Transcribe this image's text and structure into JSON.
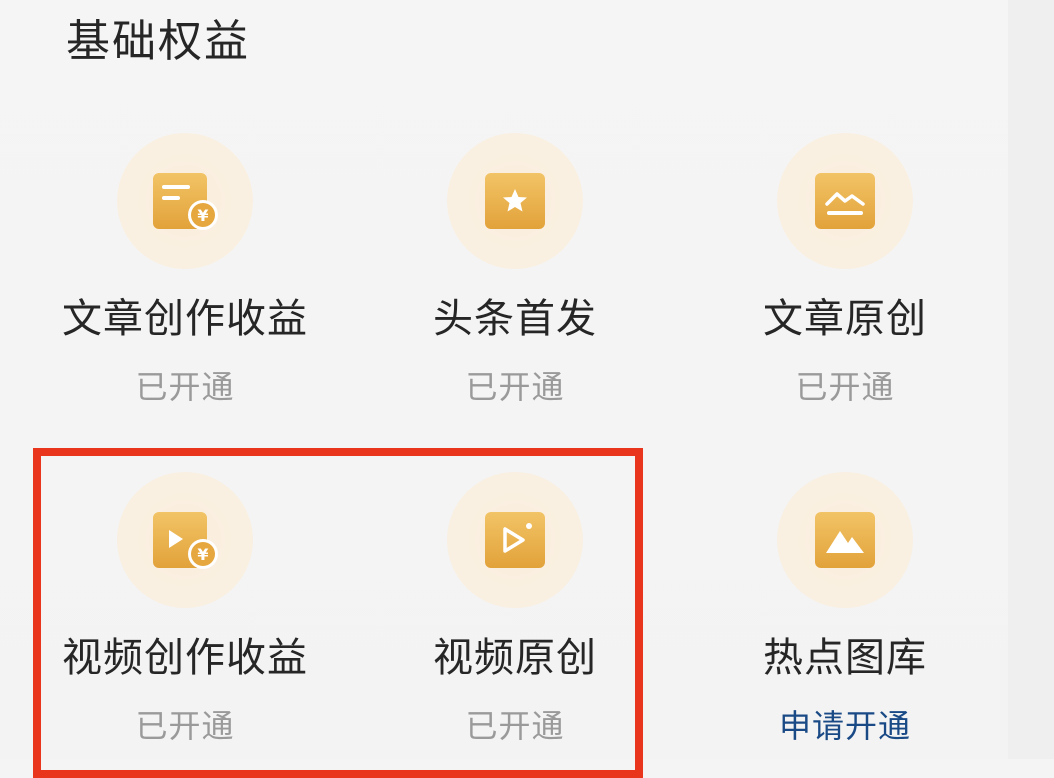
{
  "section": {
    "title": "基础权益"
  },
  "benefits": [
    {
      "name": "文章创作收益",
      "status": "已开通",
      "icon": "article-income-icon"
    },
    {
      "name": "头条首发",
      "status": "已开通",
      "icon": "star-icon"
    },
    {
      "name": "文章原创",
      "status": "已开通",
      "icon": "chart-line-icon"
    },
    {
      "name": "视频创作收益",
      "status": "已开通",
      "icon": "video-income-icon"
    },
    {
      "name": "视频原创",
      "status": "已开通",
      "icon": "video-play-icon"
    },
    {
      "name": "热点图库",
      "status": "申请开通",
      "icon": "mountain-image-icon"
    }
  ],
  "colors": {
    "icon_gold": "#e9b04e",
    "status_gray": "#9a9a9a",
    "apply_link": "#1a4a86",
    "highlight_red": "#e8351c"
  }
}
